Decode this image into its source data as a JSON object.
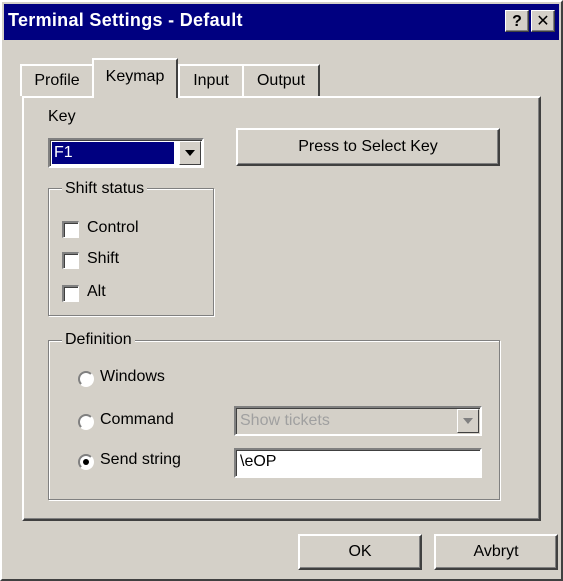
{
  "window": {
    "title": "Terminal Settings - Default",
    "help_label": "?",
    "close_label": "✕"
  },
  "tabs": [
    {
      "label": "Profile",
      "active": false
    },
    {
      "label": "Keymap",
      "active": true
    },
    {
      "label": "Input",
      "active": false
    },
    {
      "label": "Output",
      "active": false
    }
  ],
  "keymap": {
    "key_label": "Key",
    "key_value": "F1",
    "press_button_label": "Press to Select Key",
    "shift_status": {
      "legend": "Shift status",
      "options": [
        {
          "label": "Control",
          "checked": false
        },
        {
          "label": "Shift",
          "checked": false
        },
        {
          "label": "Alt",
          "checked": false
        }
      ]
    },
    "definition": {
      "legend": "Definition",
      "options": [
        {
          "label": "Windows",
          "selected": false
        },
        {
          "label": "Command",
          "selected": false
        },
        {
          "label": "Send string",
          "selected": true
        }
      ],
      "command_value": "Show tickets",
      "send_string_value": "\\eOP"
    }
  },
  "footer": {
    "ok_label": "OK",
    "cancel_label": "Avbryt"
  },
  "colors": {
    "titlebar": "#000080",
    "face": "#d4d0c8",
    "selection": "#000080"
  }
}
